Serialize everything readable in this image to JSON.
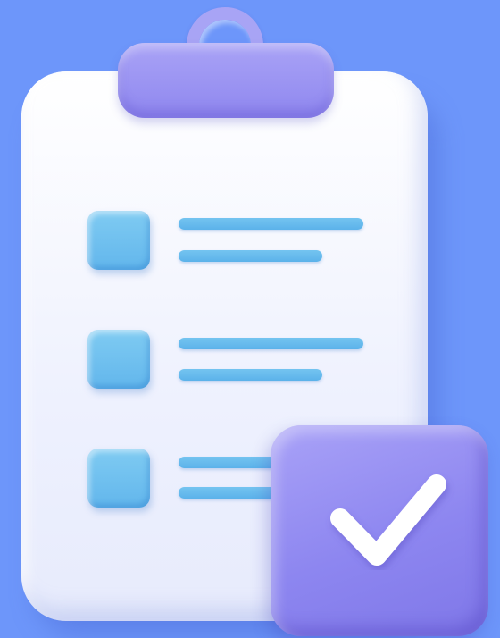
{
  "illustration": {
    "subject": "clipboard-checklist",
    "checklist_items": 3,
    "completed": true,
    "colors": {
      "background": "#6d96fa",
      "board": "#f1f3fe",
      "clip": "#9a93f3",
      "item_box": "#6dbdee",
      "line": "#66b9ec",
      "check_badge": "#958def",
      "check_mark": "#ffffff"
    },
    "icons": [
      "clipboard-icon",
      "checkbox-icon",
      "checkmark-icon"
    ]
  }
}
